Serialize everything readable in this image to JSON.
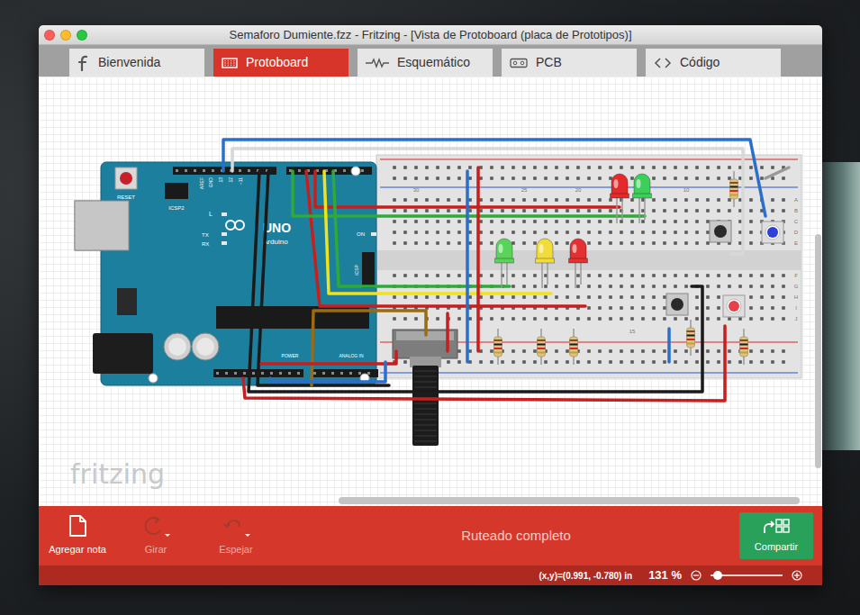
{
  "window": {
    "title": "Semaforo Dumiente.fzz - Fritzing - [Vista de Protoboard (placa de Prototipos)]"
  },
  "tabs": [
    {
      "label": "Bienvenida",
      "selected": false
    },
    {
      "label": "Protoboard",
      "selected": true
    },
    {
      "label": "Esquemático",
      "selected": false
    },
    {
      "label": "PCB",
      "selected": false
    },
    {
      "label": "Código",
      "selected": false
    }
  ],
  "canvas": {
    "board_labels": [
      "RESET",
      "ICSP2",
      "AREF",
      "GND",
      "13",
      "12",
      "~11",
      "TX",
      "RX",
      "L",
      "UNO",
      "Arduino",
      "ON",
      "ICSP",
      "POWER",
      "ANALOG IN"
    ],
    "breadboard_labels": [
      "30",
      "25",
      "20",
      "10",
      "15",
      "A",
      "B",
      "C",
      "D",
      "E",
      "F",
      "G",
      "H",
      "I",
      "J"
    ],
    "watermark": "fritzing",
    "leds": [
      {
        "color": "#e42a2a",
        "kind": "led"
      },
      {
        "color": "#3ccf5a",
        "kind": "led"
      },
      {
        "color": "#5ad35a",
        "kind": "led"
      },
      {
        "color": "#f2dc3a",
        "kind": "led"
      },
      {
        "color": "#e43030",
        "kind": "led"
      },
      {
        "color": "#2f3fd8",
        "kind": "round"
      },
      {
        "color": "#e8404a",
        "kind": "round"
      }
    ],
    "wires": [
      {
        "color": "#2a6fc9"
      },
      {
        "color": "#d8d8d8"
      },
      {
        "color": "#1a1a1a"
      },
      {
        "color": "#1a1a1a"
      },
      {
        "color": "#c81e1e"
      },
      {
        "color": "#c81e1e"
      },
      {
        "color": "#2faa3a"
      },
      {
        "color": "#2faa3a"
      },
      {
        "color": "#f2e21c"
      },
      {
        "color": "#9b6b12"
      },
      {
        "color": "#c81e1e"
      },
      {
        "color": "#c81e1e"
      },
      {
        "color": "#2a6fc9"
      },
      {
        "color": "#2a6fc9"
      },
      {
        "color": "#c81e1e"
      },
      {
        "color": "#2a6fc9"
      },
      {
        "color": "#c81e1e"
      },
      {
        "color": "#999999"
      }
    ]
  },
  "toolbar": {
    "buttons": [
      {
        "label": "Agregar nota",
        "disabled": false
      },
      {
        "label": "Girar",
        "disabled": true
      },
      {
        "label": "Espejar",
        "disabled": true
      }
    ],
    "status": "Ruteado completo",
    "share": "Compartir"
  },
  "status_bar": {
    "coords": "(x,y)=(0.991, -0.780) in",
    "zoom": "131 %",
    "zoom_level": 0.1
  }
}
